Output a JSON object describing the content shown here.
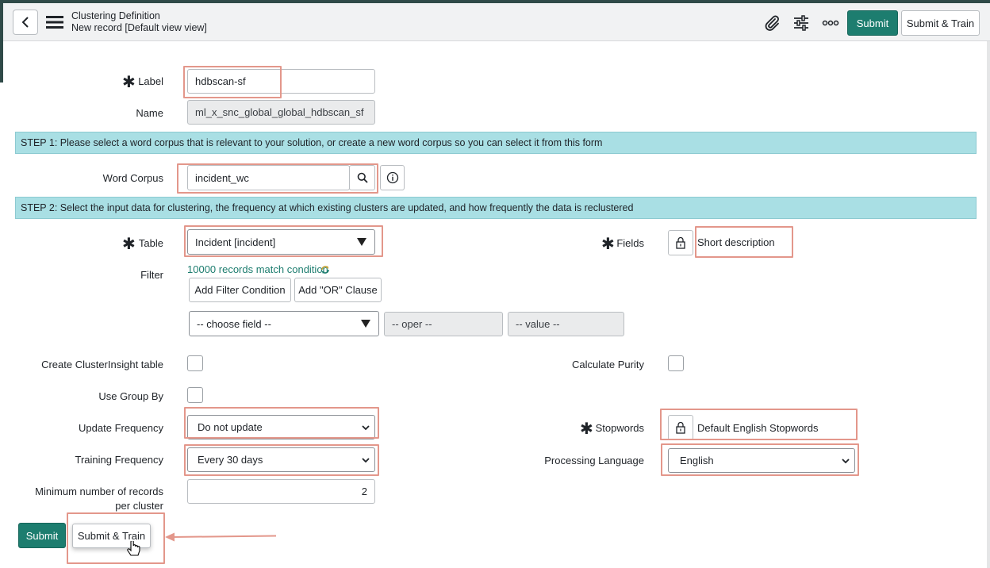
{
  "header": {
    "title": "Clustering Definition",
    "subtitle": "New record [Default view view]",
    "submit_label": "Submit",
    "submit_train_label": "Submit & Train"
  },
  "form": {
    "label": {
      "label": "Label",
      "value": "hdbscan-sf"
    },
    "name": {
      "label": "Name",
      "value": "ml_x_snc_global_global_hdbscan_sf"
    },
    "step1": "STEP 1: Please select a word corpus that is relevant to your solution, or create a new word corpus so you can select it from this form",
    "word_corpus": {
      "label": "Word Corpus",
      "value": "incident_wc"
    },
    "step2": "STEP 2: Select the input data for clustering, the frequency at which existing clusters are updated, and how frequently the data is reclustered",
    "table": {
      "label": "Table",
      "value": "Incident [incident]"
    },
    "fields": {
      "label": "Fields",
      "value": "Short description"
    },
    "filter": {
      "label": "Filter",
      "match_text": "10000 records match condition",
      "add_condition": "Add Filter Condition",
      "add_or": "Add \"OR\" Clause",
      "choose_field": "-- choose field --",
      "oper": "-- oper --",
      "value": "-- value --"
    },
    "create_cluster_insight": {
      "label": "Create ClusterInsight table",
      "checked": false
    },
    "calculate_purity": {
      "label": "Calculate Purity",
      "checked": false
    },
    "use_group_by": {
      "label": "Use Group By",
      "checked": false
    },
    "update_frequency": {
      "label": "Update Frequency",
      "value": "Do not update"
    },
    "stopwords": {
      "label": "Stopwords",
      "value": "Default English Stopwords"
    },
    "training_frequency": {
      "label": "Training Frequency",
      "value": "Every 30 days"
    },
    "processing_language": {
      "label": "Processing Language",
      "value": "English"
    },
    "min_records": {
      "label_line1": "Minimum number of records",
      "label_line2": "per cluster",
      "value": "2"
    }
  },
  "footer": {
    "submit_label": "Submit",
    "submit_train_label": "Submit & Train"
  },
  "colors": {
    "brand": "#1d7d6f",
    "step_bar": "#a9dfe4",
    "highlight": "#e3978b"
  },
  "icons": [
    "back-icon",
    "hamburger-menu-icon",
    "paperclip-icon",
    "sliders-icon",
    "more-icon",
    "search-icon",
    "info-icon",
    "lock-icon",
    "chevron-down-icon",
    "refresh-icon",
    "pointer-cursor-icon",
    "arrow-left-icon"
  ]
}
